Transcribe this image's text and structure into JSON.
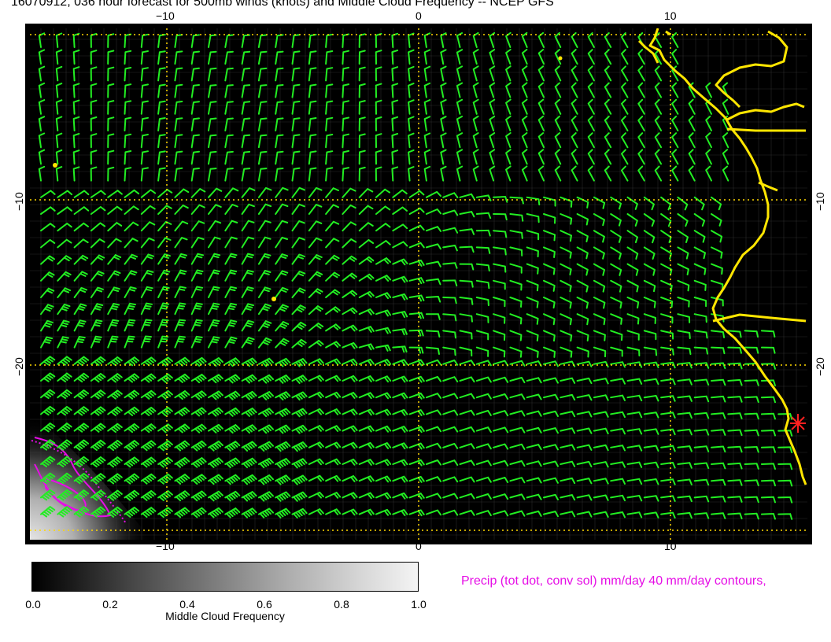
{
  "title": "16070912, 036 hour forecast for 500mb winds (knots) and Middle Cloud Frequency -- NCEP GFS",
  "axes": {
    "x_top": [
      "−10",
      "0",
      "10"
    ],
    "x_bottom": [
      "−10",
      "0",
      "10"
    ],
    "y_left": [
      "−10",
      "−20"
    ],
    "y_right": [
      "−10",
      "−20"
    ]
  },
  "colorbar": {
    "ticks": [
      "0.0",
      "0.2",
      "0.4",
      "0.6",
      "0.8",
      "1.0"
    ],
    "label": "Middle Cloud Frequency"
  },
  "precip_note": "Precip (tot dot, conv sol) mm/day 40 mm/day contours,",
  "colors": {
    "background": "#000000",
    "wind_barb": "#22ee22",
    "coastline": "#ffe600",
    "grid": "#ffd700",
    "precip": "#e60ee6",
    "marker": "#ff2020"
  }
}
